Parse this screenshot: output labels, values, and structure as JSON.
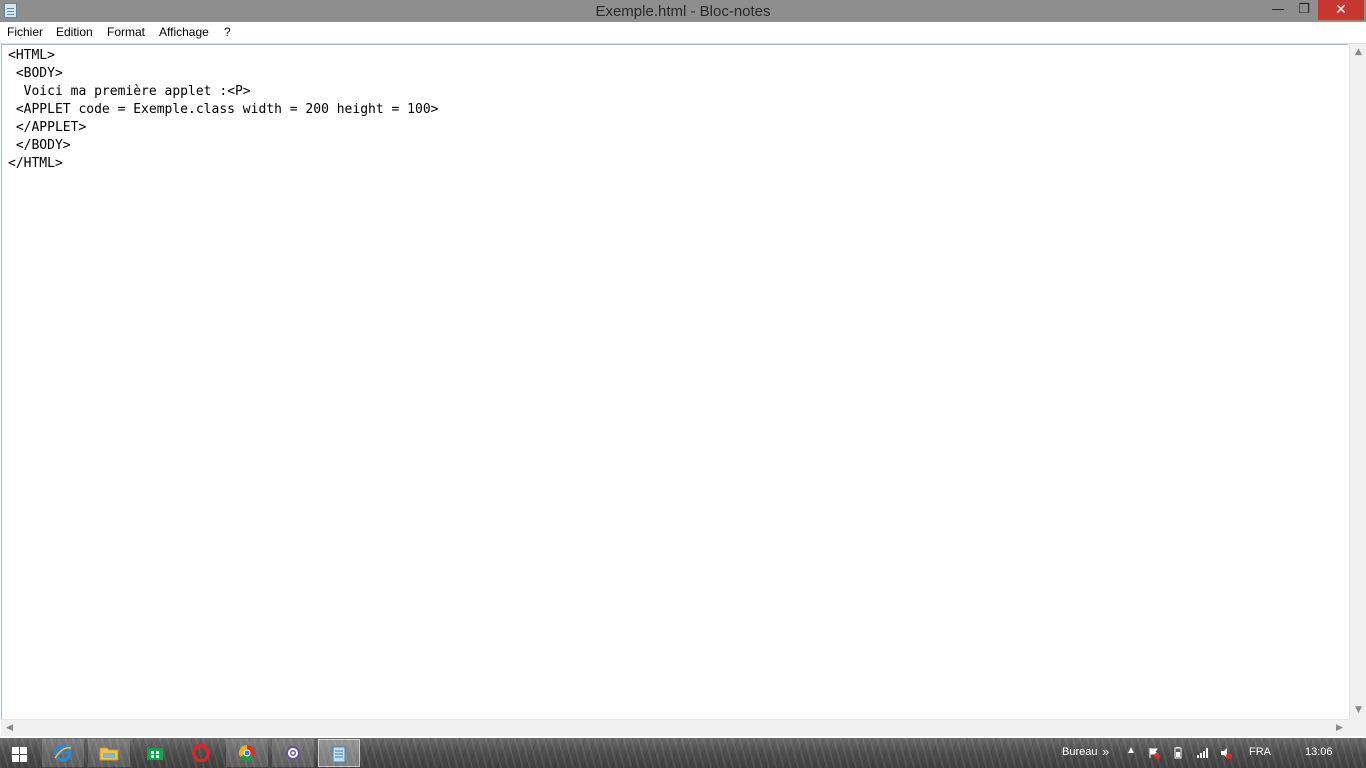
{
  "window": {
    "title": "Exemple.html - Bloc-notes",
    "controls": {
      "minimize": "—",
      "maximize": "❐",
      "close": "✕"
    }
  },
  "menu": {
    "items": [
      "Fichier",
      "Edition",
      "Format",
      "Affichage",
      "?"
    ]
  },
  "editor": {
    "content": "<HTML>\n <BODY>\n  Voici ma première applet :<P>\n <APPLET code = Exemple.class width = 200 height = 100>\n </APPLET>\n </BODY>\n</HTML>"
  },
  "taskbar": {
    "apps": [
      {
        "name": "start-button",
        "icon": "windows-logo-icon"
      },
      {
        "name": "internet-explorer",
        "icon": "internet-explorer-icon",
        "color": "#1e8fd8"
      },
      {
        "name": "file-explorer",
        "icon": "folder-icon",
        "color": "#f2c24c"
      },
      {
        "name": "store",
        "icon": "store-icon",
        "color": "#17a34a"
      },
      {
        "name": "opera",
        "icon": "opera-icon",
        "color": "#e0242b"
      },
      {
        "name": "chrome",
        "icon": "chrome-icon",
        "color": "#e6b321"
      },
      {
        "name": "settings",
        "icon": "gear-icon",
        "color": "#6a4fa0"
      },
      {
        "name": "notepad",
        "icon": "notepad-icon",
        "color": "#bfe0f2"
      }
    ],
    "tray": {
      "desktop_label": "Bureau",
      "language": "FRA",
      "time": "13:06"
    }
  }
}
